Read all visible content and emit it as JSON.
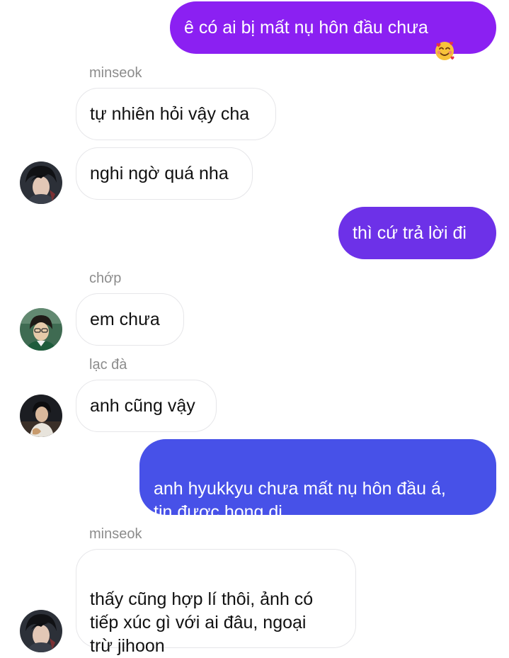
{
  "colors": {
    "outgoing_purple": "#8b20f2",
    "outgoing_violet": "#6d31e8",
    "outgoing_blue": "#4751e8",
    "incoming_bg": "#ffffff",
    "incoming_border": "#e6e6e9",
    "sender_name": "#8c8c8c"
  },
  "messages": [
    {
      "direction": "outgoing",
      "text": "ê có ai bị mất nụ hôn đầu chưa",
      "emoji": "smiling-face-with-hearts-icon"
    },
    {
      "direction": "incoming",
      "sender": "minseok",
      "text": "tự nhiên hỏi vậy cha"
    },
    {
      "direction": "incoming",
      "text": "nghi ngờ quá nha"
    },
    {
      "direction": "outgoing",
      "text": "thì cứ trả lời đi"
    },
    {
      "direction": "incoming",
      "sender": "chớp",
      "text": "em chưa"
    },
    {
      "direction": "incoming",
      "sender": "lạc đà",
      "text": "anh cũng vậy"
    },
    {
      "direction": "outgoing",
      "text": "anh hyukkyu chưa mất nụ hôn đầu á,\ntin được hong dị"
    },
    {
      "direction": "incoming",
      "sender": "minseok",
      "text": "thấy cũng hợp lí thôi, ảnh có\ntiếp xúc gì với ai đâu, ngoại\ntrừ jihoon"
    }
  ]
}
